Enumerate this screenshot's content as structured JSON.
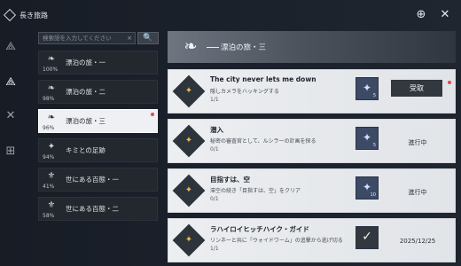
{
  "app": {
    "title": "長き旅路"
  },
  "search": {
    "placeholder": "検索語を入力してください",
    "clear_icon": "×",
    "button_icon": "🔍"
  },
  "rail": [
    {
      "name": "rail-item-1",
      "glyph": "⟁",
      "active": false,
      "dot": false
    },
    {
      "name": "rail-item-2",
      "glyph": "⟁",
      "active": true,
      "dot": true
    },
    {
      "name": "rail-item-3",
      "glyph": "✕",
      "active": false,
      "dot": false
    },
    {
      "name": "rail-item-4",
      "glyph": "⊞",
      "active": false,
      "dot": false
    }
  ],
  "categories": [
    {
      "label": "漂泊の旅・一",
      "pct": "100%",
      "icon": "feather-icon",
      "glyph": "❧",
      "selected": false,
      "dot": false
    },
    {
      "label": "漂泊の旅・二",
      "pct": "98%",
      "icon": "feather-icon",
      "glyph": "❧",
      "selected": false,
      "dot": false
    },
    {
      "label": "漂泊の旅・三",
      "pct": "96%",
      "icon": "feather-icon",
      "glyph": "❧",
      "selected": true,
      "dot": true
    },
    {
      "label": "キミとの足跡",
      "pct": "94%",
      "icon": "spark-icon",
      "glyph": "✦",
      "selected": false,
      "dot": false
    },
    {
      "label": "世にある百態・一",
      "pct": "41%",
      "icon": "crest-icon",
      "glyph": "⚜",
      "selected": false,
      "dot": false
    },
    {
      "label": "世にある百態・二",
      "pct": "58%",
      "icon": "crest-icon",
      "glyph": "⚜",
      "selected": false,
      "dot": false
    }
  ],
  "header": {
    "title": "漂泊の旅・三",
    "icon": "feather-icon",
    "glyph": "❧"
  },
  "quests": [
    {
      "title": "The city never lets me down",
      "desc": "隠しカメラをハッキングする",
      "progress": "1/1",
      "reward_count": "5",
      "reward_icon": "crystal-icon",
      "reward_glyph": "✦",
      "status": "受取",
      "claimable": true,
      "dot": true
    },
    {
      "title": "潜入",
      "desc": "秘密の審査官として、ルシラーの計画を探る",
      "progress": "0/1",
      "reward_count": "5",
      "reward_icon": "crystal-icon",
      "reward_glyph": "✦",
      "status": "進行中",
      "claimable": false,
      "dot": false
    },
    {
      "title": "目指すは、空",
      "desc": "滞空の続き「目指すは、空」をクリア",
      "progress": "0/1",
      "reward_count": "10",
      "reward_icon": "crystal-icon",
      "reward_glyph": "✦",
      "status": "進行中",
      "claimable": false,
      "dot": false
    },
    {
      "title": "ラハイロイヒッチハイク・ガイド",
      "desc": "リンネーと共に「ウォイドワーム」の追撃から逃げ切る",
      "progress": "1/1",
      "reward_count": "",
      "reward_icon": "check-icon",
      "reward_glyph": "✓",
      "status": "2025/12/25",
      "claimable": false,
      "dot": false
    }
  ]
}
